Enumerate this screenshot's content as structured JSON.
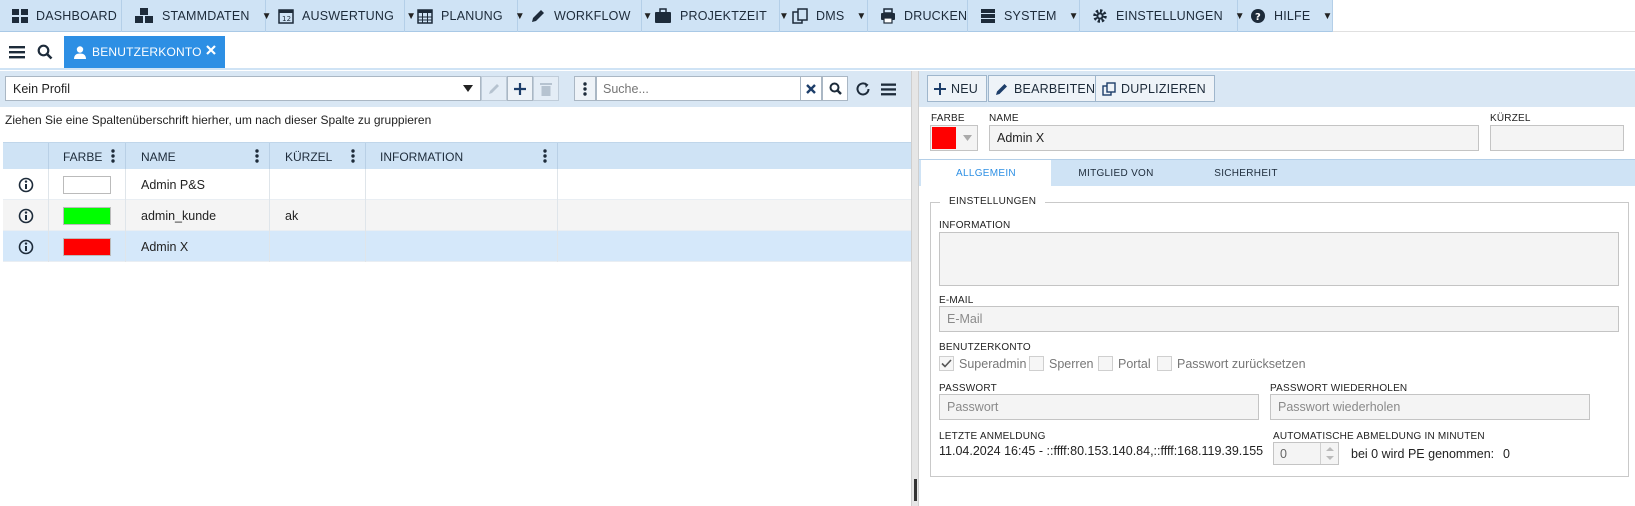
{
  "nav": {
    "items": [
      {
        "label": "DASHBOARD",
        "icon": "dashboard-icon",
        "caret": false
      },
      {
        "label": "STAMMDATEN",
        "icon": "cubes-icon",
        "caret": true
      },
      {
        "label": "AUSWERTUNG",
        "icon": "calendar-icon",
        "caret": true
      },
      {
        "label": "PLANUNG",
        "icon": "calendar-grid-icon",
        "caret": true
      },
      {
        "label": "WORKFLOW",
        "icon": "pencil-icon",
        "caret": true
      },
      {
        "label": "PROJEKTZEIT",
        "icon": "briefcase-icon",
        "caret": true
      },
      {
        "label": "DMS",
        "icon": "copy-icon",
        "caret": true
      },
      {
        "label": "DRUCKEN",
        "icon": "print-icon",
        "caret": false
      },
      {
        "label": "SYSTEM",
        "icon": "server-icon",
        "caret": true
      },
      {
        "label": "EINSTELLUNGEN",
        "icon": "gear-icon",
        "caret": true
      },
      {
        "label": "HILFE",
        "icon": "question-icon",
        "caret": true
      }
    ]
  },
  "tab": {
    "label": "BENUTZERKONTO"
  },
  "left": {
    "profile": "Kein Profil",
    "search_placeholder": "Suche...",
    "group_hint": "Ziehen Sie eine Spaltenüberschrift hierher, um nach dieser Spalte zu gruppieren",
    "columns": [
      "FARBE",
      "NAME",
      "KÜRZEL",
      "INFORMATION"
    ],
    "rows": [
      {
        "color": "#ffffff",
        "name": "Admin P&S",
        "kuerzel": ""
      },
      {
        "color": "#00ff00",
        "name": "admin_kunde",
        "kuerzel": "ak"
      },
      {
        "color": "#ff0000",
        "name": "Admin X",
        "kuerzel": ""
      }
    ]
  },
  "right": {
    "buttons": {
      "new": "NEU",
      "edit": "BEARBEITEN",
      "duplicate": "DUPLIZIEREN"
    },
    "labels": {
      "farbe": "FARBE",
      "name": "NAME",
      "kuerzel": "KÜRZEL"
    },
    "color_value": "#ff0000",
    "name_value": "Admin X",
    "kuerzel_value": "",
    "tabs": [
      "ALLGEMEIN",
      "MITGLIED VON",
      "SICHERHEIT"
    ],
    "settings": {
      "legend": "EINSTELLUNGEN",
      "information_label": "INFORMATION",
      "email_label": "E-MAIL",
      "email_placeholder": "E-Mail",
      "account_label": "BENUTZERKONTO",
      "checkboxes": [
        {
          "label": "Superadmin",
          "checked": true
        },
        {
          "label": "Sperren",
          "checked": false
        },
        {
          "label": "Portal",
          "checked": false
        },
        {
          "label": "Passwort zurücksetzen",
          "checked": false
        }
      ],
      "password_label": "PASSWORT",
      "password_placeholder": "Passwort",
      "password_repeat_label": "PASSWORT WIEDERHOLEN",
      "password_repeat_placeholder": "Passwort wiederholen",
      "last_login_label": "LETZTE ANMELDUNG",
      "last_login_value": "11.04.2024 16:45 - ::ffff:80.153.140.84,::ffff:168.119.39.155",
      "auto_logout_label": "AUTOMATISCHE ABMELDUNG IN MINUTEN",
      "auto_logout_value": "0",
      "auto_logout_hint": "bei 0 wird PE genommen:",
      "auto_logout_hint_value": "0"
    }
  },
  "colors": {
    "accent": "#2d8fe4",
    "nav_bg": "#cfe3f5",
    "toolbar_bg": "#d9e7f4",
    "selected_row": "#d5e8fa"
  }
}
